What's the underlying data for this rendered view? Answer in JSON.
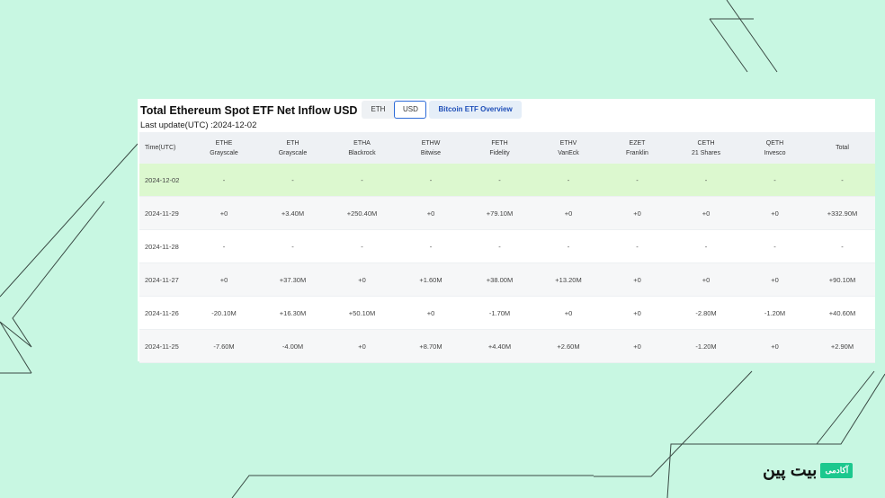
{
  "header": {
    "title": "Total Ethereum Spot ETF Net Inflow USD",
    "toggle": [
      "ETH",
      "USD"
    ],
    "active_toggle": "USD",
    "overview_button": "Bitcoin ETF Overview",
    "last_update": "Last update(UTC) :2024-12-02"
  },
  "table": {
    "columns": [
      {
        "ticker": "Time(UTC)",
        "issuer": ""
      },
      {
        "ticker": "ETHE",
        "issuer": "Grayscale"
      },
      {
        "ticker": "ETH",
        "issuer": "Grayscale"
      },
      {
        "ticker": "ETHA",
        "issuer": "Blackrock"
      },
      {
        "ticker": "ETHW",
        "issuer": "Bitwise"
      },
      {
        "ticker": "FETH",
        "issuer": "Fidelity"
      },
      {
        "ticker": "ETHV",
        "issuer": "VanEck"
      },
      {
        "ticker": "EZET",
        "issuer": "Franklin"
      },
      {
        "ticker": "CETH",
        "issuer": "21 Shares"
      },
      {
        "ticker": "QETH",
        "issuer": "Invesco"
      },
      {
        "ticker": "Total",
        "issuer": ""
      }
    ],
    "rows": [
      {
        "cells": [
          "2024-12-02",
          "-",
          "-",
          "-",
          "-",
          "-",
          "-",
          "-",
          "-",
          "-",
          "-"
        ]
      },
      {
        "cells": [
          "2024-11-29",
          "+0",
          "+3.40M",
          "+250.40M",
          "+0",
          "+79.10M",
          "+0",
          "+0",
          "+0",
          "+0",
          "+332.90M"
        ]
      },
      {
        "cells": [
          "2024-11-28",
          "-",
          "-",
          "-",
          "-",
          "-",
          "-",
          "-",
          "-",
          "-",
          "-"
        ]
      },
      {
        "cells": [
          "2024-11-27",
          "+0",
          "+37.30M",
          "+0",
          "+1.60M",
          "+38.00M",
          "+13.20M",
          "+0",
          "+0",
          "+0",
          "+90.10M"
        ]
      },
      {
        "cells": [
          "2024-11-26",
          "-20.10M",
          "+16.30M",
          "+50.10M",
          "+0",
          "-1.70M",
          "+0",
          "+0",
          "-2.80M",
          "-1.20M",
          "+40.60M"
        ]
      },
      {
        "cells": [
          "2024-11-25",
          "-7.60M",
          "-4.00M",
          "+0",
          "+8.70M",
          "+4.40M",
          "+2.60M",
          "+0",
          "-1.20M",
          "+0",
          "+2.90M"
        ]
      }
    ]
  },
  "brand": {
    "word": "بیت پین",
    "badge": "آکادمی"
  },
  "colors": {
    "background": "#c8f7e2",
    "positive": "#17a37a",
    "negative": "#e23a45",
    "highlight_row": "#dcf8cf",
    "accent": "#2d6bd8",
    "brand_badge": "#1cc88e"
  }
}
